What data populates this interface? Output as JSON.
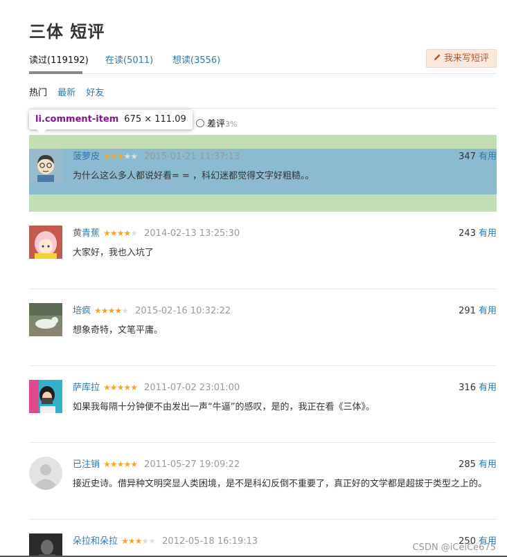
{
  "page": {
    "title": "三体 短评"
  },
  "tabs": [
    {
      "label": "读过(119192)",
      "active": true
    },
    {
      "label": "在读(5011)",
      "active": false
    },
    {
      "label": "想读(3556)",
      "active": false
    }
  ],
  "write_button": {
    "label": "我来写短评",
    "icon": "pencil-icon"
  },
  "sort": [
    {
      "label": "热门",
      "active": true
    },
    {
      "label": "最新",
      "active": false
    },
    {
      "label": "好友",
      "active": false
    }
  ],
  "filters": {
    "partial_suffix": "%",
    "bad": {
      "label": "差评",
      "pct": "3%"
    }
  },
  "devtools_tooltip": {
    "selector": "li.comment-item",
    "size": "675 × 111.09"
  },
  "comments": [
    {
      "user": "菠萝皮",
      "stars": 3,
      "time": "2015-01-21 11:37:13",
      "votes": "347",
      "useful": "有用",
      "text": "为什么这么多人都说好看= = ，科幻迷都觉得文字好粗糙。。",
      "avatar": "cartoon-boy"
    },
    {
      "user": "黄青蕉",
      "stars": 4,
      "time": "2014-02-13 13:25:30",
      "votes": "243",
      "useful": "有用",
      "text": "大家好，我也入坑了",
      "avatar": "anime-girl"
    },
    {
      "user": "培疯",
      "stars": 4,
      "time": "2015-02-16 10:32:22",
      "votes": "291",
      "useful": "有用",
      "text": "想象奇特，文笔平庸。",
      "avatar": "dog-photo"
    },
    {
      "user": "萨库拉",
      "stars": 5,
      "time": "2011-07-02 23:01:00",
      "votes": "316",
      "useful": "有用",
      "text": "如果我每隔十分钟便不由发出一声“牛逼”的感叹，是的，我正在看《三体》。",
      "avatar": "girl-camera"
    },
    {
      "user": "已注销",
      "stars": 5,
      "time": "2011-05-27 19:09:22",
      "votes": "285",
      "useful": "有用",
      "text": "接近史诗。借异种文明突显人类困境，是不是科幻反倒不重要了，真正好的文学都是超拔于类型之上的。",
      "avatar": "default-user"
    },
    {
      "user": "朵拉和朵拉",
      "stars": 3,
      "time": "2012-05-18 16:19:13",
      "votes": "250",
      "useful": "有用",
      "text": "",
      "avatar": "dark-photo"
    }
  ],
  "watermark": "CSDN @iCeiCe675"
}
